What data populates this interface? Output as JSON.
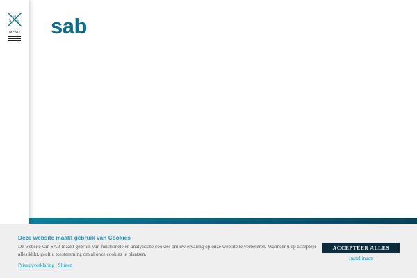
{
  "sidebar": {
    "logo_letters": [
      "s",
      "a",
      "b"
    ],
    "menu_label": "MENU"
  },
  "header": {
    "brand": "sab"
  },
  "colors": {
    "brand": "#0b6e87",
    "band_start": "#0d7f9c",
    "band_end": "#083f58",
    "cookie_bg": "#efefef",
    "accent": "#1a95bf",
    "button_bg": "#0b2a3a"
  },
  "cookie_banner": {
    "title": "Deze website maakt gebruik van Cookies",
    "body": "De website van SAB maakt gebruik van functionele en analytische cookies om uw ervaring op onze website te verbeteren. Wanneer u op accepteer alles klikt, geeft u toestemming om al onze cookies te plaatsen.",
    "privacy_link": "Privacyverklaring",
    "separator": "|",
    "close_link": "Sluiten",
    "accept_button": "ACCEPTEER ALLES",
    "settings_link": "Instellingen"
  }
}
